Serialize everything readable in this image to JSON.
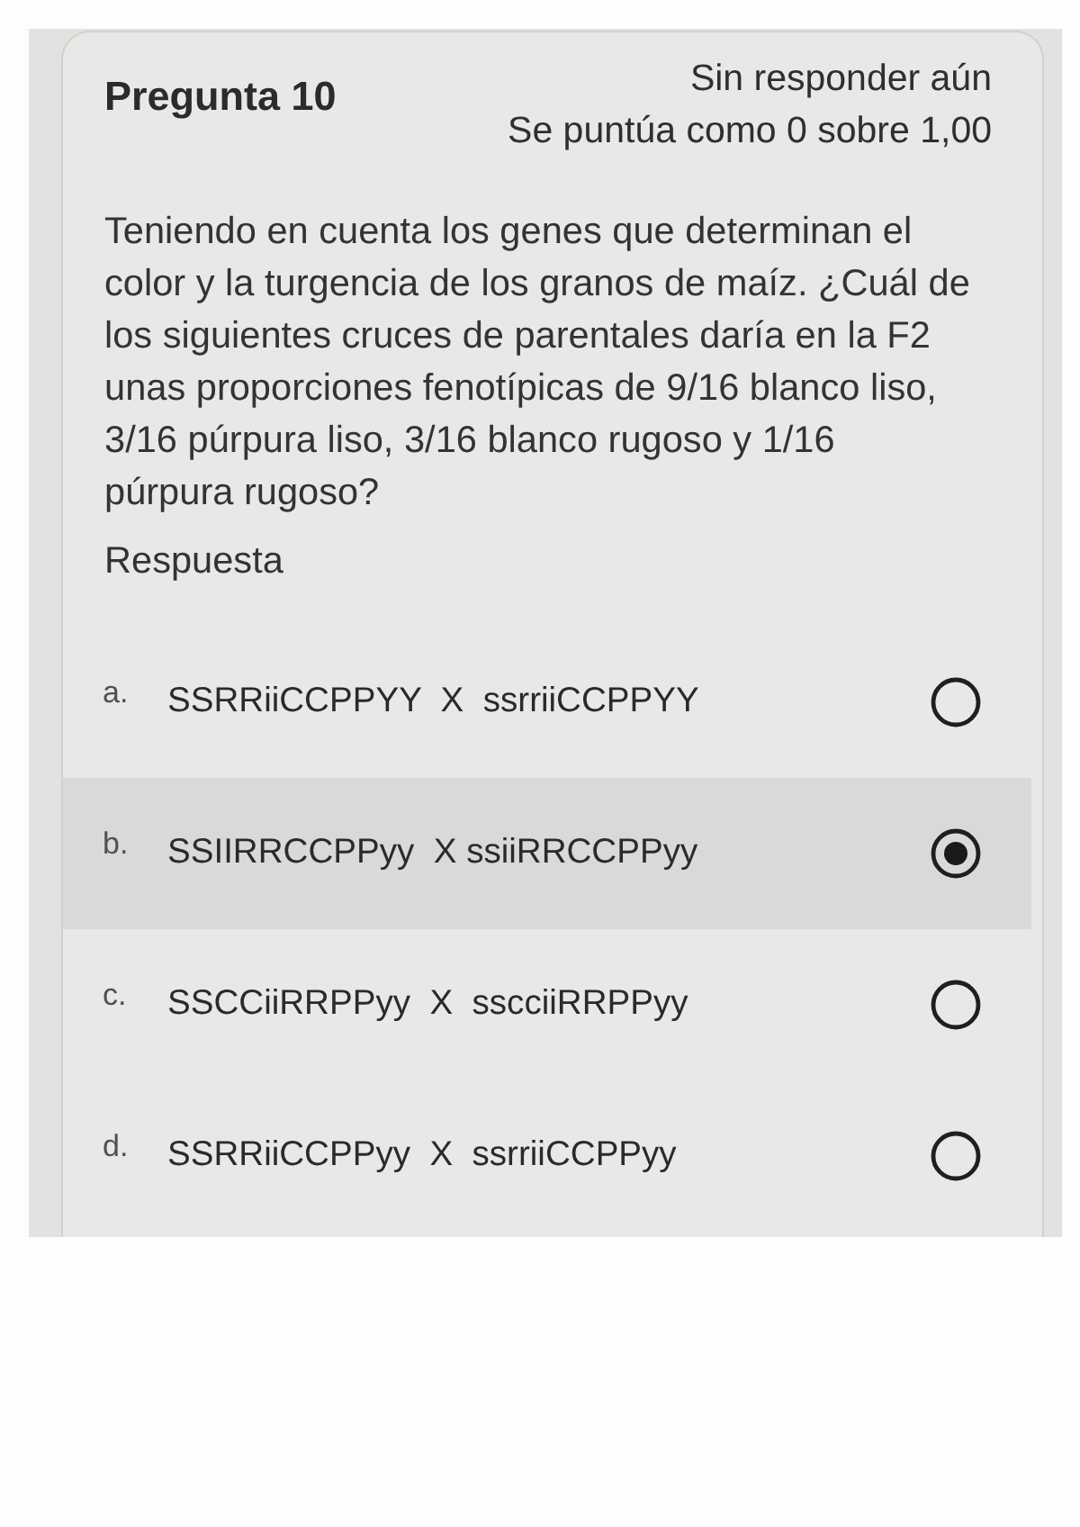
{
  "question": {
    "title": "Pregunta 10",
    "status": "Sin responder aún",
    "grade": "Se puntúa como 0 sobre 1,00",
    "text": "Teniendo en cuenta los genes que determinan el\ncolor y la turgencia de los granos de maíz. ¿Cuál de\nlos siguientes cruces de parentales daría en la F2\nunas proporciones fenotípicas de 9/16 blanco liso,\n3/16 púrpura liso, 3/16 blanco rugoso y 1/16\npúrpura rugoso?",
    "answer_label": "Respuesta",
    "options": [
      {
        "letter": "a.",
        "text": "SSRRiiCCPPYY  X  ssrriiCCPPYY",
        "selected": false
      },
      {
        "letter": "b.",
        "text": "SSIIRRCCPPyy  X ssiiRRCCPPyy",
        "selected": true
      },
      {
        "letter": "c.",
        "text": "SSCCiiRRPPyy  X  sscciiRRPPyy",
        "selected": false
      },
      {
        "letter": "d.",
        "text": "SSRRiiCCPPyy  X  ssrriiCCPPyy",
        "selected": false
      }
    ]
  }
}
